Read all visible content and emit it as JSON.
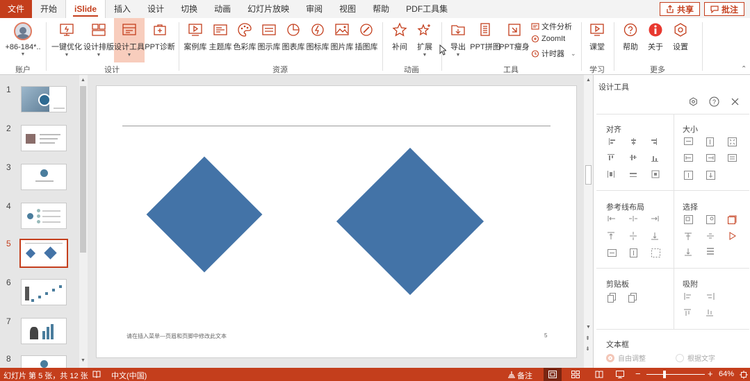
{
  "menu": {
    "tabs": [
      "文件",
      "开始",
      "iSlide",
      "插入",
      "设计",
      "切换",
      "动画",
      "幻灯片放映",
      "审阅",
      "视图",
      "帮助",
      "PDF工具集"
    ],
    "share": "共享",
    "comment": "批注"
  },
  "ribbon": {
    "account": {
      "name": "+86-184*..",
      "label": "账户"
    },
    "design": {
      "label": "设计",
      "buttons": [
        "一键优化",
        "设计排版",
        "设计工具",
        "PPT诊断"
      ]
    },
    "resources": {
      "label": "资源",
      "buttons": [
        "案例库",
        "主题库",
        "色彩库",
        "图示库",
        "图表库",
        "图标库",
        "图片库",
        "插图库"
      ]
    },
    "animation": {
      "label": "动画",
      "buttons": [
        "补间",
        "扩展"
      ]
    },
    "tools": {
      "label": "工具",
      "buttons": [
        "导出",
        "PPT拼图",
        "PPT瘦身"
      ],
      "small": [
        "文件分析",
        "ZoomIt",
        "计时器"
      ]
    },
    "learn": {
      "label": "学习",
      "buttons": [
        "课堂"
      ]
    },
    "more": {
      "label": "更多",
      "buttons": [
        "帮助",
        "关于",
        "设置"
      ]
    }
  },
  "thumbnails": {
    "numbers": [
      "1",
      "2",
      "3",
      "4",
      "5",
      "6",
      "7",
      "8"
    ],
    "selected": "5"
  },
  "slide": {
    "footer": "请在插入菜单—页眉和页脚中修改此文本",
    "page_number": "5",
    "shape_color": "#4373a7"
  },
  "panel": {
    "title": "设计工具",
    "sections": {
      "align": "对齐",
      "size": "大小",
      "guides": "参考线布局",
      "select": "选择",
      "clipboard": "剪贴板",
      "snap": "吸附",
      "textbox": "文本框"
    },
    "textbox_options": [
      "自由调整",
      "根据文字"
    ]
  },
  "status": {
    "slide_info": "幻灯片 第 5 张，共 12 张",
    "language": "中文(中国)",
    "notes": "备注",
    "zoom": "64%"
  },
  "colors": {
    "accent": "#c43e1c",
    "selected_button": "#f8cdbd"
  }
}
